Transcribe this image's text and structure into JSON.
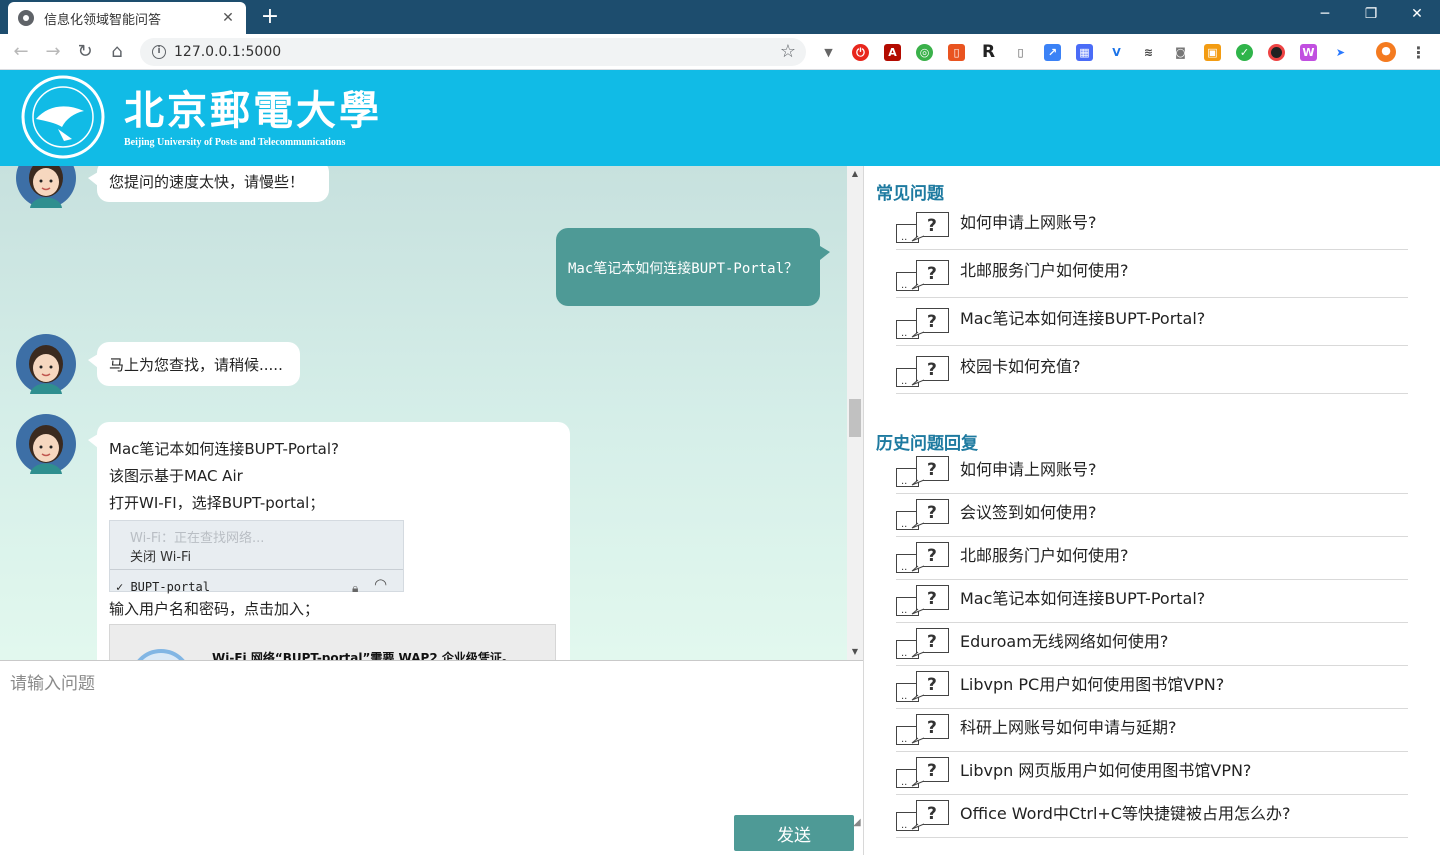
{
  "browser": {
    "tab_title": "信息化领域智能问答",
    "tab_close": "✕",
    "new_tab": "+",
    "url": "127.0.0.1:5000",
    "window_controls": {
      "minimize": "─",
      "restore": "❐",
      "close": "✕"
    }
  },
  "header": {
    "title_cn": "北京郵電大學",
    "title_en": "Beijing University of Posts and Telecommunications"
  },
  "chat": {
    "messages": [
      {
        "from": "bot",
        "text": "您提问的速度太快，请慢些！"
      },
      {
        "from": "user",
        "text": "Mac笔记本如何连接BUPT-Portal？"
      },
      {
        "from": "bot",
        "text": "马上为您查找，请稍候....."
      },
      {
        "from": "bot",
        "lines": [
          "Mac笔记本如何连接BUPT-Portal?",
          "该图示基于MAC Air",
          "打开WI-FI，选择BUPT-portal；"
        ],
        "wifi_menu": {
          "searching": "Wi-Fi：正在查找网络...",
          "turn_off": "关闭 Wi-Fi",
          "network": "BUPT-portal"
        },
        "line_after_image": "输入用户名和密码，点击加入；",
        "wap_dialog": "Wi-Fi 网络“BUPT-portal”需要 WAP2 企业级凭证。"
      }
    ]
  },
  "input": {
    "placeholder": "请输入问题",
    "send_label": "发送"
  },
  "faq": {
    "title": "常见问题",
    "items": [
      "如何申请上网账号?",
      "北邮服务门户如何使用?",
      "Mac笔记本如何连接BUPT-Portal?",
      "校园卡如何充值?"
    ]
  },
  "history": {
    "title": "历史问题回复",
    "items": [
      "如何申请上网账号?",
      "会议签到如何使用?",
      "北邮服务门户如何使用?",
      "Mac笔记本如何连接BUPT-Portal?",
      "Eduroam无线网络如何使用?",
      "Libvpn PC用户如何使用图书馆VPN?",
      "科研上网账号如何申请与延期?",
      "Libvpn 网页版用户如何使用图书馆VPN?",
      "Office Word中Ctrl+C等快捷键被占用怎么办?"
    ]
  },
  "colors": {
    "header_bg": "#11bbe6",
    "accent_teal": "#4e9a96",
    "section_title": "#1e7aa0"
  }
}
